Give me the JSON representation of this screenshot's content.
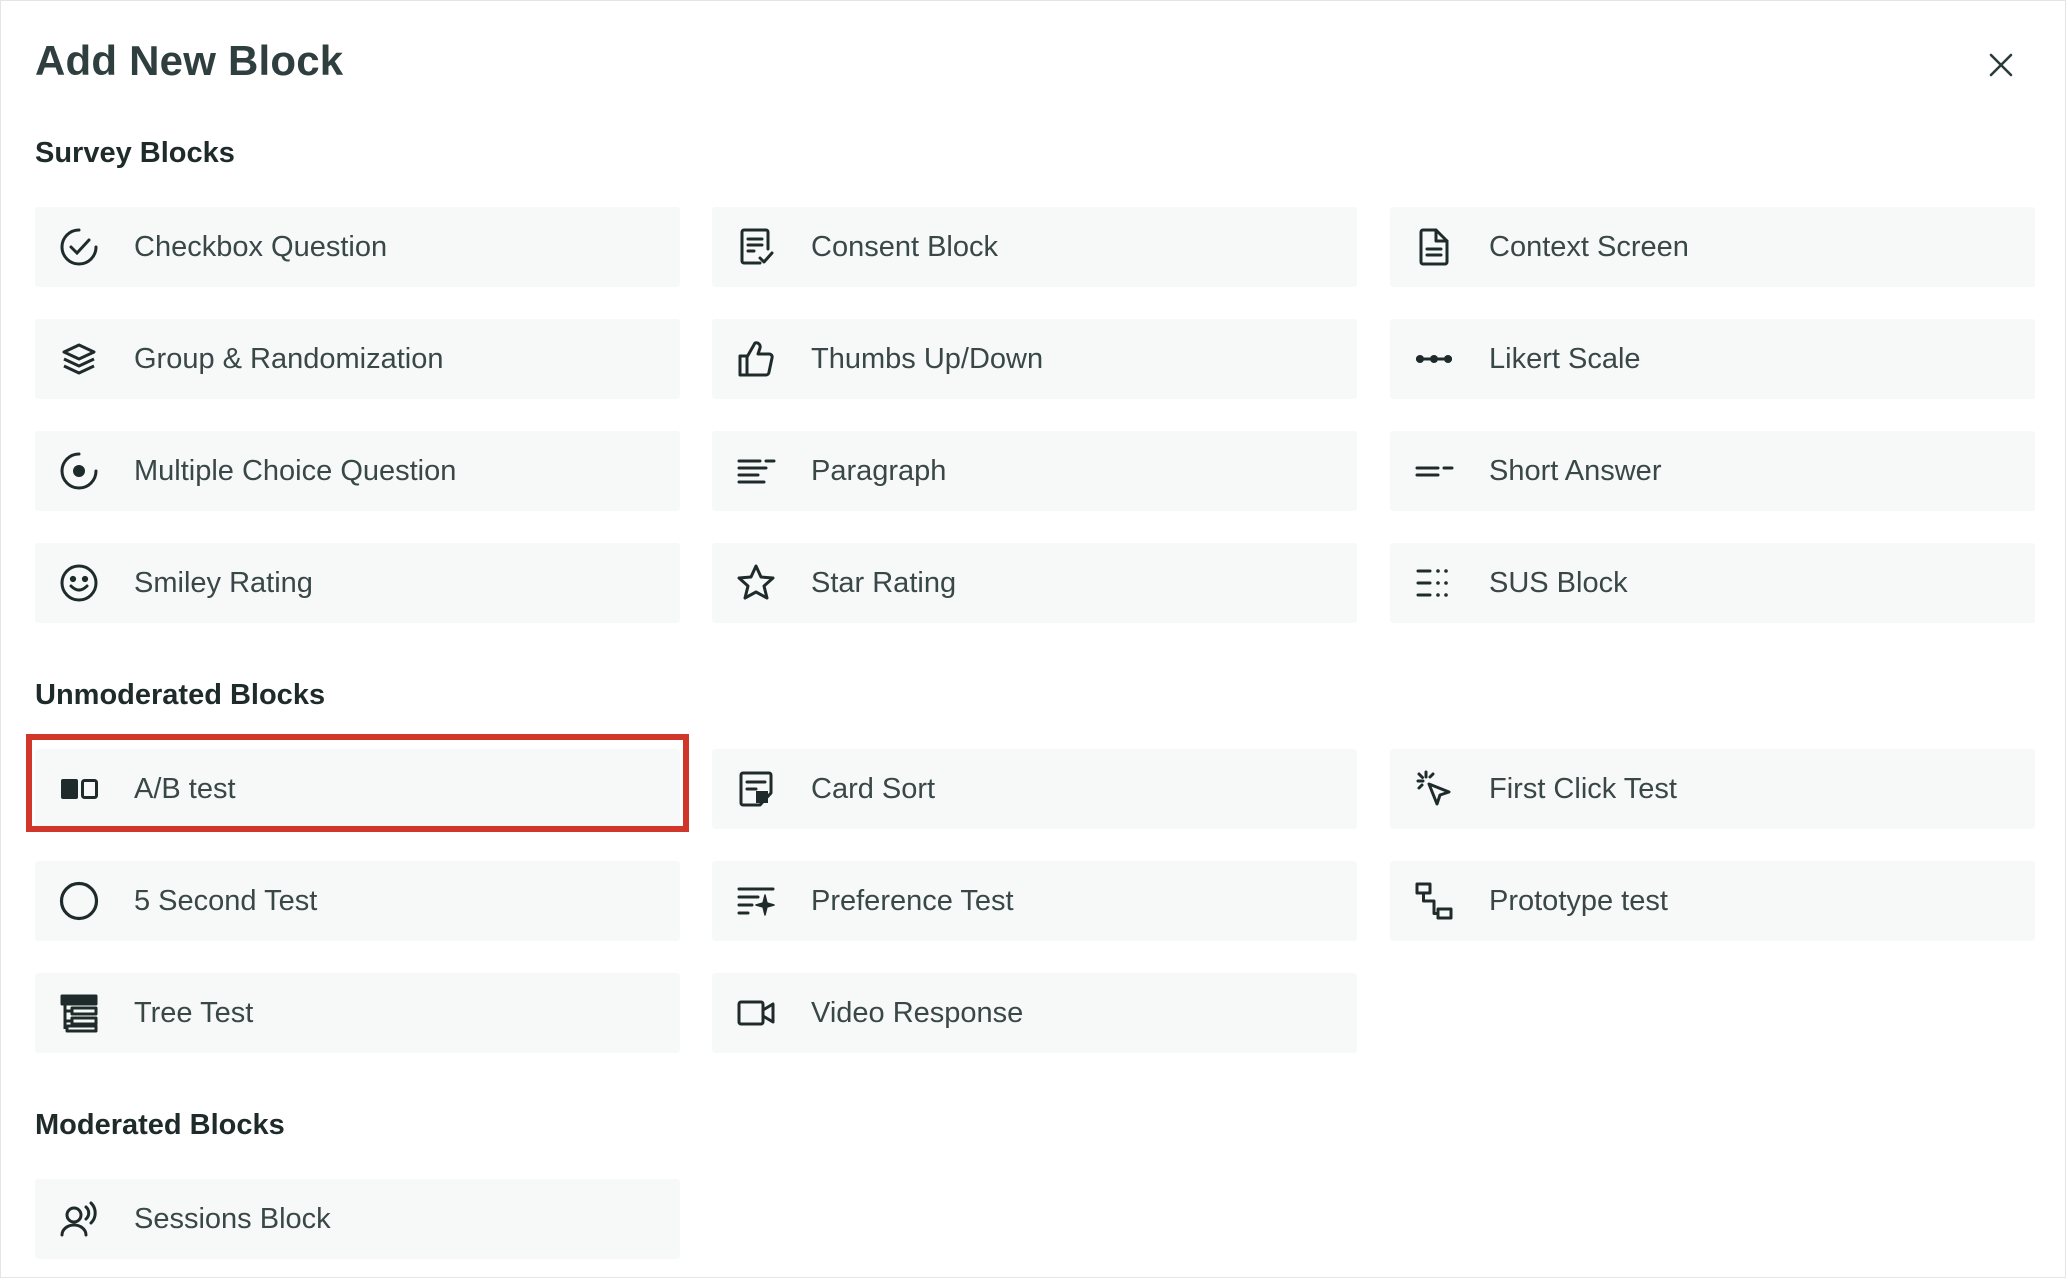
{
  "dialog": {
    "title": "Add New Block",
    "close_icon": "close-icon"
  },
  "sections": {
    "survey": {
      "title": "Survey Blocks"
    },
    "unmoderated": {
      "title": "Unmoderated Blocks"
    },
    "moderated": {
      "title": "Moderated Blocks"
    }
  },
  "blocks": {
    "checkbox_question": {
      "label": "Checkbox Question",
      "icon": "check-circle-icon"
    },
    "consent_block": {
      "label": "Consent Block",
      "icon": "document-check-icon"
    },
    "context_screen": {
      "label": "Context Screen",
      "icon": "file-text-icon"
    },
    "group_randomization": {
      "label": "Group & Randomization",
      "icon": "layers-icon"
    },
    "thumbs_up_down": {
      "label": "Thumbs Up/Down",
      "icon": "thumbs-up-icon"
    },
    "likert_scale": {
      "label": "Likert Scale",
      "icon": "dots-line-icon"
    },
    "multiple_choice_question": {
      "label": "Multiple Choice Question",
      "icon": "radio-icon"
    },
    "paragraph": {
      "label": "Paragraph",
      "icon": "paragraph-icon"
    },
    "short_answer": {
      "label": "Short Answer",
      "icon": "short-text-icon"
    },
    "smiley_rating": {
      "label": "Smiley Rating",
      "icon": "smiley-icon"
    },
    "star_rating": {
      "label": "Star Rating",
      "icon": "star-icon"
    },
    "sus_block": {
      "label": "SUS Block",
      "icon": "list-grid-icon"
    },
    "ab_test": {
      "label": "A/B test",
      "icon": "ab-squares-icon"
    },
    "card_sort": {
      "label": "Card Sort",
      "icon": "card-sort-icon"
    },
    "first_click_test": {
      "label": "First Click Test",
      "icon": "cursor-click-icon"
    },
    "five_second_test": {
      "label": "5 Second Test",
      "icon": "circle-icon"
    },
    "preference_test": {
      "label": "Preference Test",
      "icon": "sparkle-list-icon"
    },
    "prototype_test": {
      "label": "Prototype test",
      "icon": "flow-icon"
    },
    "tree_test": {
      "label": "Tree Test",
      "icon": "tree-icon"
    },
    "video_response": {
      "label": "Video Response",
      "icon": "video-icon"
    },
    "sessions_block": {
      "label": "Sessions Block",
      "icon": "user-voice-icon"
    }
  },
  "colors": {
    "card_bg": "#f7f8f8",
    "text": "#3a4747",
    "heading": "#1f2b2b",
    "highlight": "#d0362a"
  }
}
